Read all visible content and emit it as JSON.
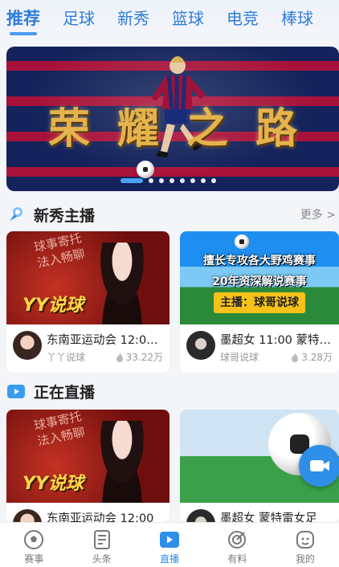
{
  "tabs": [
    {
      "label": "推荐",
      "active": true
    },
    {
      "label": "足球"
    },
    {
      "label": "新秀"
    },
    {
      "label": "篮球"
    },
    {
      "label": "电竞"
    },
    {
      "label": "棒球"
    }
  ],
  "banner": {
    "title": "荣耀之路",
    "slide_count": 8,
    "current_slide": 1
  },
  "sections": {
    "rookie": {
      "title": "新秀主播",
      "more": "更多 >"
    },
    "live": {
      "title": "正在直播"
    }
  },
  "rookie_cards": [
    {
      "thumb_text": "YY说球",
      "thumb_handwriting": "球事寄托\n法入畅聊",
      "title": "东南亚运动会 12:00...",
      "author": "丫丫说球",
      "views": "33.22万"
    },
    {
      "thumb_line1": "擅长专攻各大野鸡赛事",
      "thumb_line2": "20年资深解说赛事",
      "thumb_badge": "主播：球哥说球",
      "title": "墨超女 11:00 蒙特雷...",
      "author": "球哥说球",
      "views": "3.28万"
    }
  ],
  "live_cards": [
    {
      "thumb_text": "YY说球",
      "thumb_handwriting": "球事寄托\n法入畅聊",
      "title": "东南亚运动会 12:00"
    },
    {
      "title": "墨超女 蒙特雷女足"
    }
  ],
  "bottom_nav": [
    {
      "label": "赛事",
      "icon": "soccer-ball-icon"
    },
    {
      "label": "头条",
      "icon": "news-icon"
    },
    {
      "label": "直播",
      "icon": "live-tv-icon",
      "active": true
    },
    {
      "label": "有料",
      "icon": "target-icon"
    },
    {
      "label": "我的",
      "icon": "profile-icon"
    }
  ],
  "colors": {
    "accent": "#2e8fe8",
    "tab_text": "#2f7cd8",
    "background": "#f3f5f9"
  }
}
